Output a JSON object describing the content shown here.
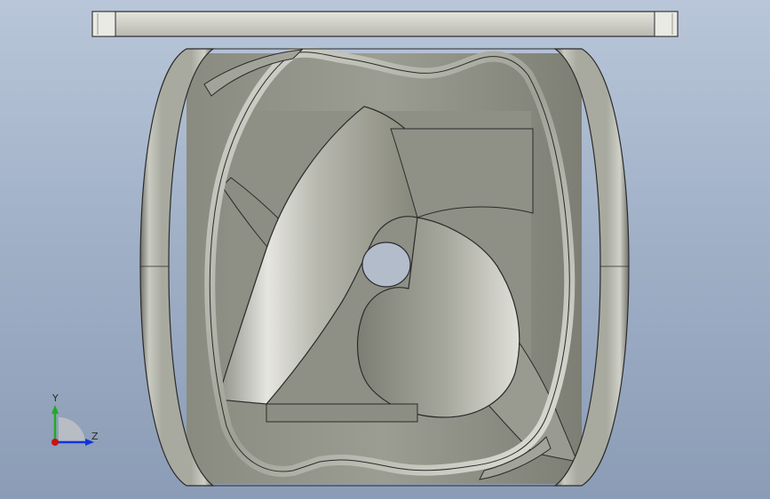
{
  "viewport": {
    "background_top": "#b9c6d9",
    "background_bottom": "#8b9cb6"
  },
  "model": {
    "part_color": "#a6a89c",
    "edge_color": "#2b2b2b",
    "top_plate_color": "#cfcfc8"
  },
  "triad": {
    "x_axis_color": "#cc1111",
    "y_axis_color": "#22aa22",
    "z_axis_color": "#1133dd",
    "y_label": "Y",
    "z_label": "Z"
  }
}
